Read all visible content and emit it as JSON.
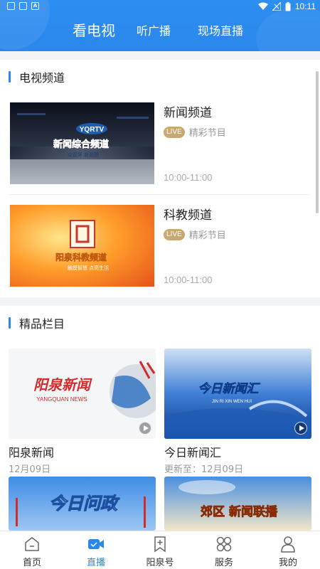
{
  "status_bar": {
    "time": "10:11"
  },
  "header": {
    "tabs": [
      {
        "label": "看电视",
        "active": true
      },
      {
        "label": "听广播",
        "active": false
      },
      {
        "label": "现场直播",
        "active": false
      }
    ]
  },
  "tv_section": {
    "title": "电视频道",
    "channels": [
      {
        "name": "新闻频道",
        "badge": "LIVE",
        "desc": "精彩节目",
        "time": "10:00-11:00",
        "thumb_text": "新闻综合频道",
        "thumb_sub": "众观界  新观野",
        "logo": "YQRTV"
      },
      {
        "name": "科教频道",
        "badge": "LIVE",
        "desc": "精彩节目",
        "time": "10:00-11:00",
        "thumb_text": "阳泉科教频道",
        "thumb_sub": "触摸智慧  点亮生活"
      }
    ]
  },
  "program_section": {
    "title": "精品栏目",
    "items": [
      {
        "title": "阳泉新闻",
        "date": "12月09日",
        "thumb_text": "阳泉新闻",
        "thumb_sub": "YANGQUAN   NEWS"
      },
      {
        "title": "今日新闻汇",
        "date": "更新至：12月09日",
        "thumb_text": "今日新闻汇",
        "thumb_sub": "JIN  RI  XIN  WEN  HUI"
      },
      {
        "title": "",
        "date": "",
        "thumb_text": "今日问政"
      },
      {
        "title": "",
        "date": "",
        "thumb_text": "郊区 新闻联播"
      }
    ]
  },
  "bottom_nav": [
    {
      "label": "首页",
      "icon": "home-icon",
      "active": false
    },
    {
      "label": "直播",
      "icon": "live-camera-icon",
      "active": true
    },
    {
      "label": "阳泉号",
      "icon": "bookmark-plus-icon",
      "active": false
    },
    {
      "label": "服务",
      "icon": "grid-services-icon",
      "active": false
    },
    {
      "label": "我的",
      "icon": "user-icon",
      "active": false
    }
  ],
  "colors": {
    "primary": "#2b87ec",
    "live_badge": "#c8a870"
  }
}
